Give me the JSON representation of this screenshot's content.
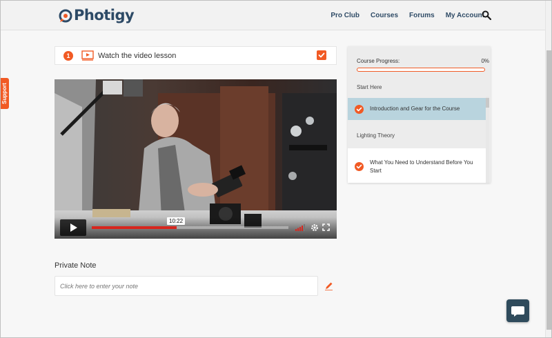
{
  "brand": {
    "name": "Photigy",
    "accent": "#f15a24",
    "navy": "#2d4a66"
  },
  "nav": {
    "items": [
      {
        "label": "Pro Club"
      },
      {
        "label": "Courses"
      },
      {
        "label": "Forums"
      },
      {
        "label": "My Account"
      }
    ],
    "search_icon": "search-icon"
  },
  "support": {
    "label": "Support"
  },
  "lesson_step": {
    "number": "1",
    "icon": "video-lesson-icon",
    "label": "Watch the video lesson",
    "completed": true
  },
  "video": {
    "tooltip_time": "10:22",
    "progress": 0.43,
    "icons": [
      "play-icon",
      "volume-icon",
      "settings-icon",
      "fullscreen-icon"
    ]
  },
  "private_note": {
    "title": "Private Note",
    "placeholder": "Click here to enter your note",
    "icon": "pencil-icon"
  },
  "course_panel": {
    "progress_label": "Course Progress:",
    "progress_value": "0%",
    "progress": 0.0,
    "sections": [
      {
        "title": "Start Here",
        "items": [
          {
            "label": "Introduction and Gear for the Course",
            "active": true,
            "done": true
          }
        ]
      },
      {
        "title": "Lighting Theory",
        "items": [
          {
            "label": "What You Need to Understand Before You Start",
            "active": false,
            "done": true
          }
        ]
      }
    ]
  },
  "chat": {
    "icon": "chat-icon"
  }
}
